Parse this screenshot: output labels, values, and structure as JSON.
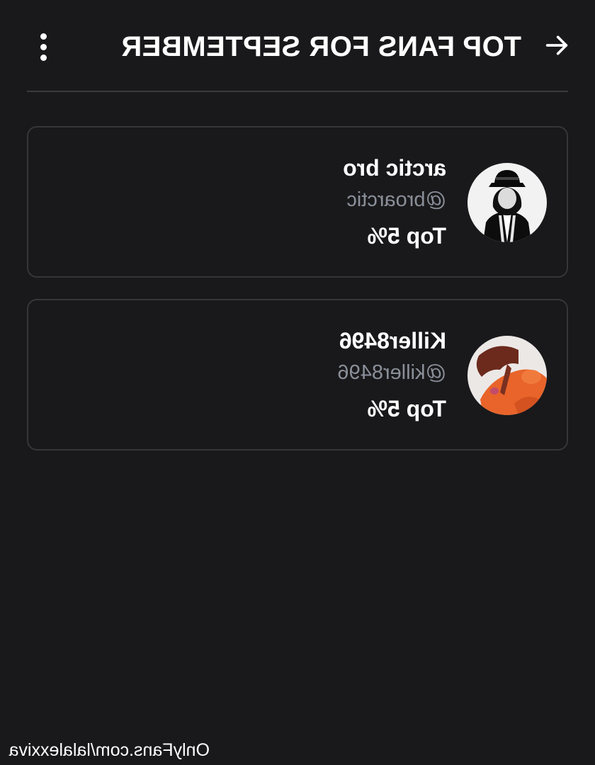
{
  "header": {
    "title": "TOP FANS FOR SEPTEMBER",
    "back_icon": "arrow-left-icon",
    "more_icon": "more-vertical-icon"
  },
  "fans": [
    {
      "name": "arctic bro",
      "handle": "@broarctic",
      "rank": "Top 5%",
      "avatar": "man-in-hat-avatar"
    },
    {
      "name": "Killer8496",
      "handle": "@killer8496",
      "rank": "Top 5%",
      "avatar": "orange-character-avatar"
    }
  ],
  "watermark": "OnlyFans.com/lalalexxiva",
  "colors": {
    "background": "#19191b",
    "card_border": "#36363a",
    "text_primary": "#ffffff",
    "text_secondary": "#8a8f99"
  }
}
